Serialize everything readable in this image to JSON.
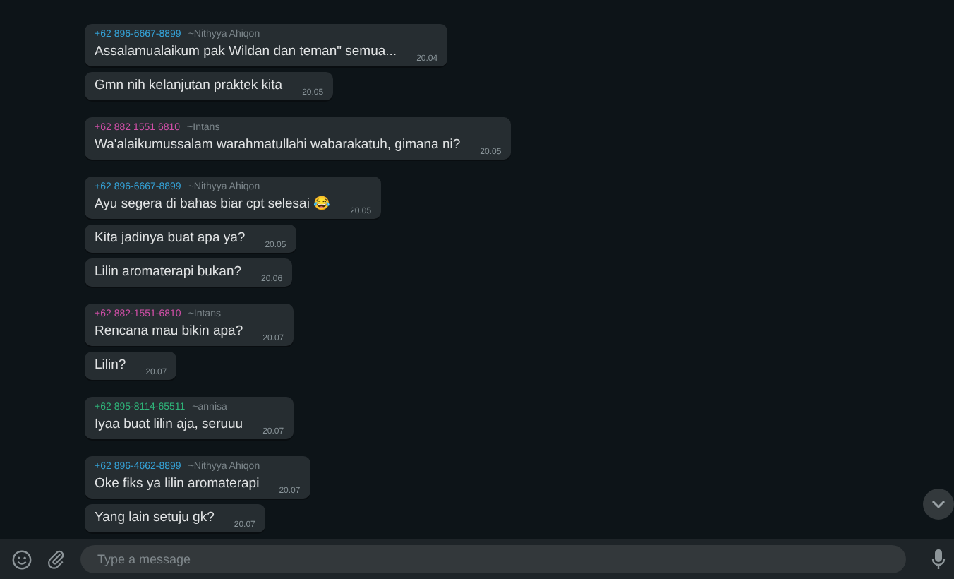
{
  "messages": [
    {
      "sender": {
        "phone": "+62 896-6667-8899",
        "name": "~Nithyya Ahiqon",
        "color": "#35a3d8"
      },
      "text": "Assalamualaikum pak Wildan dan teman\" semua...",
      "time": "20.04"
    },
    {
      "text": "Gmn nih kelanjutan praktek kita",
      "time": "20.05"
    },
    {
      "sender": {
        "phone": "+62 882 1551 6810",
        "name": "~Intans",
        "color": "#d14fa8"
      },
      "text": "Wa'alaikumussalam warahmatullahi wabarakatuh, gimana ni?",
      "time": "20.05"
    },
    {
      "sender": {
        "phone": "+62 896-6667-8899",
        "name": "~Nithyya Ahiqon",
        "color": "#35a3d8"
      },
      "text": "Ayu segera di bahas biar cpt selesai 😂",
      "time": "20.05"
    },
    {
      "text": "Kita jadinya buat apa ya?",
      "time": "20.05"
    },
    {
      "text": "Lilin aromaterapi bukan?",
      "time": "20.06"
    },
    {
      "sender": {
        "phone": "+62 882-1551-6810",
        "name": "~Intans",
        "color": "#d14fa8"
      },
      "text": "Rencana mau bikin apa?",
      "time": "20.07"
    },
    {
      "text": "Lilin?",
      "time": "20.07"
    },
    {
      "sender": {
        "phone": "+62 895-8114-65511",
        "name": "~annisa",
        "color": "#2fb57a"
      },
      "text": "Iyaa buat lilin aja, seruuu",
      "time": "20.07"
    },
    {
      "sender": {
        "phone": "+62 896-4662-8899",
        "name": "~Nithyya Ahiqon",
        "color": "#35a3d8"
      },
      "text": "Oke fiks ya lilin aromaterapi",
      "time": "20.07"
    },
    {
      "text": "Yang lain setuju gk?",
      "time": "20.07"
    }
  ],
  "composer": {
    "placeholder": "Type a message"
  }
}
